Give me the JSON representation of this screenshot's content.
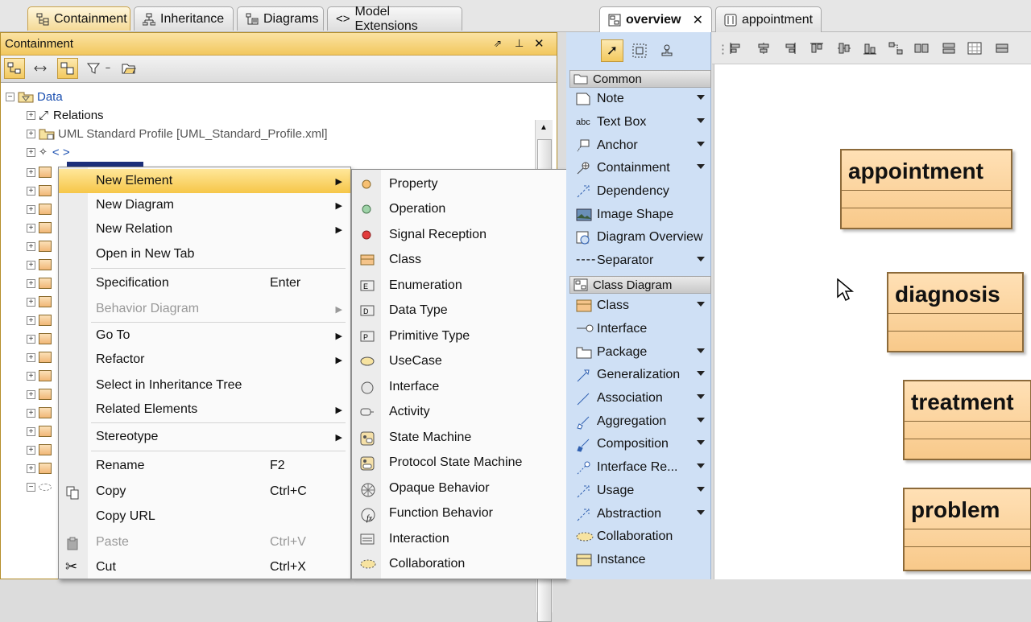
{
  "left_tabs": [
    {
      "label": "Containment",
      "icon": "containment-icon",
      "active": true
    },
    {
      "label": "Inheritance",
      "icon": "inheritance-icon",
      "active": false
    },
    {
      "label": "Diagrams",
      "icon": "diagrams-icon",
      "active": false
    },
    {
      "label": "Model Extensions",
      "icon": "model-extensions-icon",
      "active": false
    }
  ],
  "containment": {
    "title": "Containment",
    "tree": [
      {
        "label": "Data",
        "icon": "package-icon",
        "color": "#1a4fb0"
      },
      {
        "label": "Relations",
        "icon": "relations-icon",
        "color": "#111"
      },
      {
        "label": "UML Standard Profile [UML_Standard_Profile.xml]",
        "icon": "profile-package-icon",
        "color": "#555"
      },
      {
        "label": "< >",
        "icon": "element-icon",
        "color": "#1a4fb0"
      }
    ]
  },
  "context_menu": {
    "items": [
      {
        "label": "New Element",
        "shortcut": "",
        "submenu": true,
        "highlighted": true,
        "disabled": false
      },
      {
        "label": "New Diagram",
        "shortcut": "",
        "submenu": true
      },
      {
        "label": "New Relation",
        "shortcut": "",
        "submenu": true
      },
      {
        "label": "Open in New Tab",
        "shortcut": "",
        "submenu": false
      },
      {
        "label": "Specification",
        "shortcut": "Enter",
        "submenu": false
      },
      {
        "label": "Behavior Diagram",
        "shortcut": "",
        "submenu": true,
        "disabled": true
      },
      {
        "label": "Go To",
        "shortcut": "",
        "submenu": true
      },
      {
        "label": "Refactor",
        "shortcut": "",
        "submenu": true
      },
      {
        "label": "Select in Inheritance Tree",
        "shortcut": "",
        "submenu": false
      },
      {
        "label": "Related Elements",
        "shortcut": "",
        "submenu": true
      },
      {
        "label": "Stereotype",
        "shortcut": "",
        "submenu": true
      },
      {
        "label": "Rename",
        "shortcut": "F2",
        "submenu": false
      },
      {
        "label": "Copy",
        "shortcut": "Ctrl+C",
        "submenu": false,
        "icon": "copy-icon"
      },
      {
        "label": "Copy URL",
        "shortcut": "",
        "submenu": false
      },
      {
        "label": "Paste",
        "shortcut": "Ctrl+V",
        "submenu": false,
        "disabled": true,
        "icon": "paste-icon"
      },
      {
        "label": "Cut",
        "shortcut": "Ctrl+X",
        "submenu": false,
        "icon": "cut-icon"
      }
    ]
  },
  "submenu": {
    "items": [
      {
        "label": "Property",
        "icon": "property-icon"
      },
      {
        "label": "Operation",
        "icon": "operation-icon"
      },
      {
        "label": "Signal Reception",
        "icon": "signal-reception-icon"
      },
      {
        "label": "Class",
        "icon": "class-icon"
      },
      {
        "label": "Enumeration",
        "icon": "enumeration-icon"
      },
      {
        "label": "Data Type",
        "icon": "data-type-icon"
      },
      {
        "label": "Primitive Type",
        "icon": "primitive-type-icon"
      },
      {
        "label": "UseCase",
        "icon": "usecase-icon"
      },
      {
        "label": "Interface",
        "icon": "interface-icon"
      },
      {
        "label": "Activity",
        "icon": "activity-icon"
      },
      {
        "label": "State Machine",
        "icon": "state-machine-icon"
      },
      {
        "label": "Protocol State Machine",
        "icon": "protocol-state-machine-icon"
      },
      {
        "label": "Opaque Behavior",
        "icon": "opaque-behavior-icon"
      },
      {
        "label": "Function Behavior",
        "icon": "function-behavior-icon"
      },
      {
        "label": "Interaction",
        "icon": "interaction-icon"
      },
      {
        "label": "Collaboration",
        "icon": "collaboration-icon"
      }
    ]
  },
  "right_tabs": [
    {
      "label": "overview",
      "active": true,
      "closable": true
    },
    {
      "label": "appointment",
      "active": false,
      "closable": false
    }
  ],
  "palette": {
    "common_title": "Common",
    "common": [
      {
        "label": "Note",
        "dropdown": true,
        "icon": "note-icon"
      },
      {
        "label": "Text Box",
        "dropdown": true,
        "icon": "text-box-icon"
      },
      {
        "label": "Anchor",
        "dropdown": true,
        "icon": "anchor-icon"
      },
      {
        "label": "Containment",
        "dropdown": true,
        "icon": "containment-icon"
      },
      {
        "label": "Dependency",
        "dropdown": false,
        "icon": "dependency-icon"
      },
      {
        "label": "Image Shape",
        "dropdown": false,
        "icon": "image-shape-icon"
      },
      {
        "label": "Diagram Overview",
        "dropdown": false,
        "icon": "diagram-overview-icon"
      },
      {
        "label": "Separator",
        "dropdown": true,
        "icon": "separator-icon"
      }
    ],
    "class_title": "Class Diagram",
    "class": [
      {
        "label": "Class",
        "dropdown": true,
        "icon": "class-icon"
      },
      {
        "label": "Interface",
        "dropdown": false,
        "icon": "interface-icon"
      },
      {
        "label": "Package",
        "dropdown": true,
        "icon": "package-icon"
      },
      {
        "label": "Generalization",
        "dropdown": true,
        "icon": "generalization-icon"
      },
      {
        "label": "Association",
        "dropdown": true,
        "icon": "association-icon"
      },
      {
        "label": "Aggregation",
        "dropdown": true,
        "icon": "aggregation-icon"
      },
      {
        "label": "Composition",
        "dropdown": true,
        "icon": "composition-icon"
      },
      {
        "label": "Interface Re...",
        "dropdown": true,
        "icon": "interface-realization-icon"
      },
      {
        "label": "Usage",
        "dropdown": true,
        "icon": "usage-icon"
      },
      {
        "label": "Abstraction",
        "dropdown": true,
        "icon": "abstraction-icon"
      },
      {
        "label": "Collaboration",
        "dropdown": false,
        "icon": "collaboration-icon"
      },
      {
        "label": "Instance",
        "dropdown": false,
        "icon": "instance-icon"
      }
    ]
  },
  "diagram": {
    "classes": [
      "appointment",
      "diagnosis",
      "treatment",
      "problem"
    ]
  },
  "colors": {
    "accent_orange": "#f3c95e",
    "palette_blue": "#cfe0f5",
    "class_fill": "#f8c98a"
  }
}
